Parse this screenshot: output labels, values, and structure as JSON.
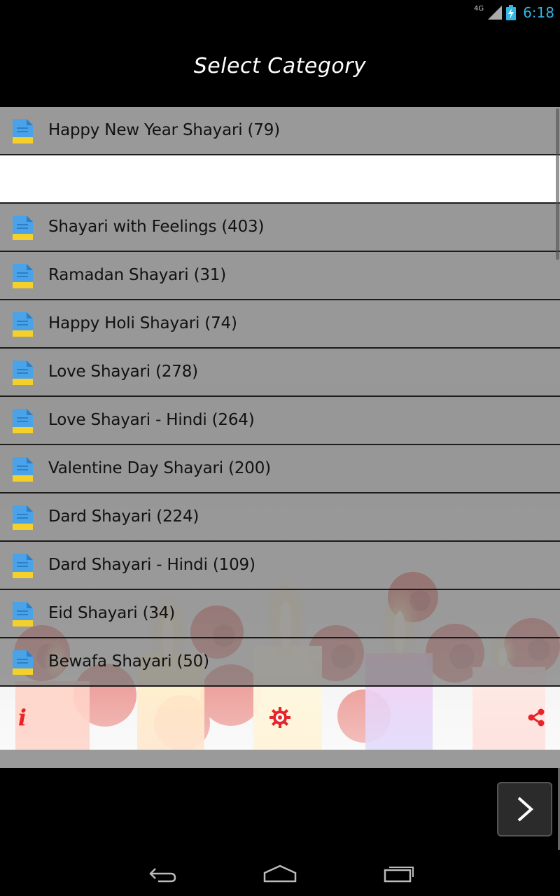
{
  "status": {
    "network": "4G",
    "time": "6:18"
  },
  "header": {
    "title": "Select Category"
  },
  "categories": [
    {
      "label": "Happy New Year Shayari (79)"
    },
    {
      "label": ""
    },
    {
      "label": "Shayari with Feelings (403)"
    },
    {
      "label": "Ramadan Shayari (31)"
    },
    {
      "label": "Happy Holi Shayari (74)"
    },
    {
      "label": "Love Shayari (278)"
    },
    {
      "label": "Love Shayari - Hindi (264)"
    },
    {
      "label": "Valentine Day Shayari (200)"
    },
    {
      "label": "Dard Shayari (224)"
    },
    {
      "label": "Dard Shayari - Hindi (109)"
    },
    {
      "label": "Eid Shayari (34)"
    },
    {
      "label": "Bewafa Shayari (50)"
    }
  ],
  "toolbar": {
    "info_glyph": "i",
    "info_icon": "info-icon",
    "settings_icon": "settings-gear-icon",
    "share_icon": "share-icon"
  },
  "ad": {
    "next_icon": "chevron-right-icon"
  },
  "nav": {
    "back_icon": "back-icon",
    "home_icon": "home-icon",
    "recents_icon": "recents-icon"
  },
  "colors": {
    "accent_red": "#e8232a",
    "status_blue": "#33b5e5",
    "doc_icon_blue": "#4aa3e8",
    "doc_icon_yellow": "#f5d02a"
  }
}
